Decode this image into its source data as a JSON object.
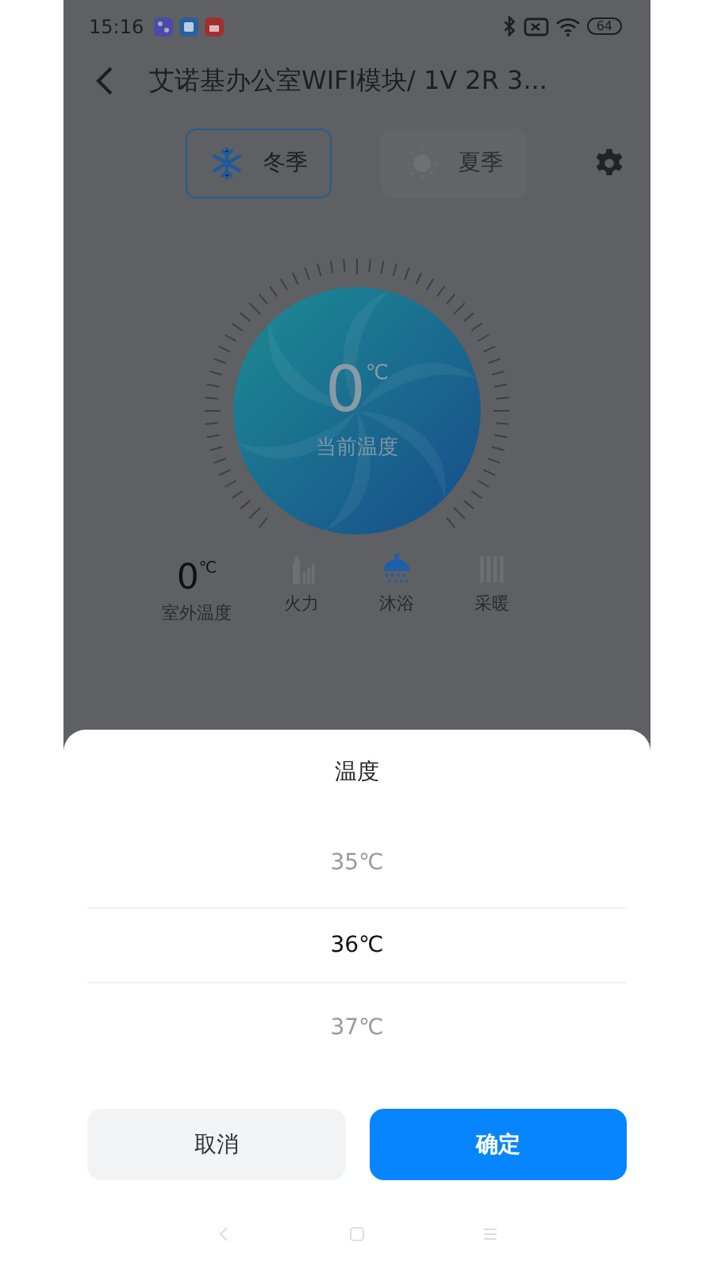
{
  "status_bar": {
    "time": "15:16",
    "battery": "64"
  },
  "header": {
    "title": "艾诺基办公室WIFI模块/ 1V 2R 3..."
  },
  "seasons": [
    {
      "kind": "winter",
      "label": "冬季",
      "selected": true
    },
    {
      "kind": "summer",
      "label": "夏季",
      "selected": false
    }
  ],
  "dial": {
    "value": "0",
    "unit": "℃",
    "label": "当前温度"
  },
  "stats": [
    {
      "kind": "temperature",
      "value": "0",
      "unit": "℃",
      "label": "室外温度"
    },
    {
      "kind": "fire",
      "label": "火力",
      "on": false
    },
    {
      "kind": "bath",
      "label": "沐浴",
      "on": true
    },
    {
      "kind": "heating",
      "label": "采暖",
      "on": false
    }
  ],
  "picker": {
    "title": "温度",
    "options": [
      {
        "label": "35℃",
        "selected": false
      },
      {
        "label": "36℃",
        "selected": true
      },
      {
        "label": "37℃",
        "selected": false
      }
    ],
    "buttons": [
      {
        "kind": "cancel",
        "label": "取消"
      },
      {
        "kind": "confirm",
        "label": "确定"
      }
    ]
  }
}
